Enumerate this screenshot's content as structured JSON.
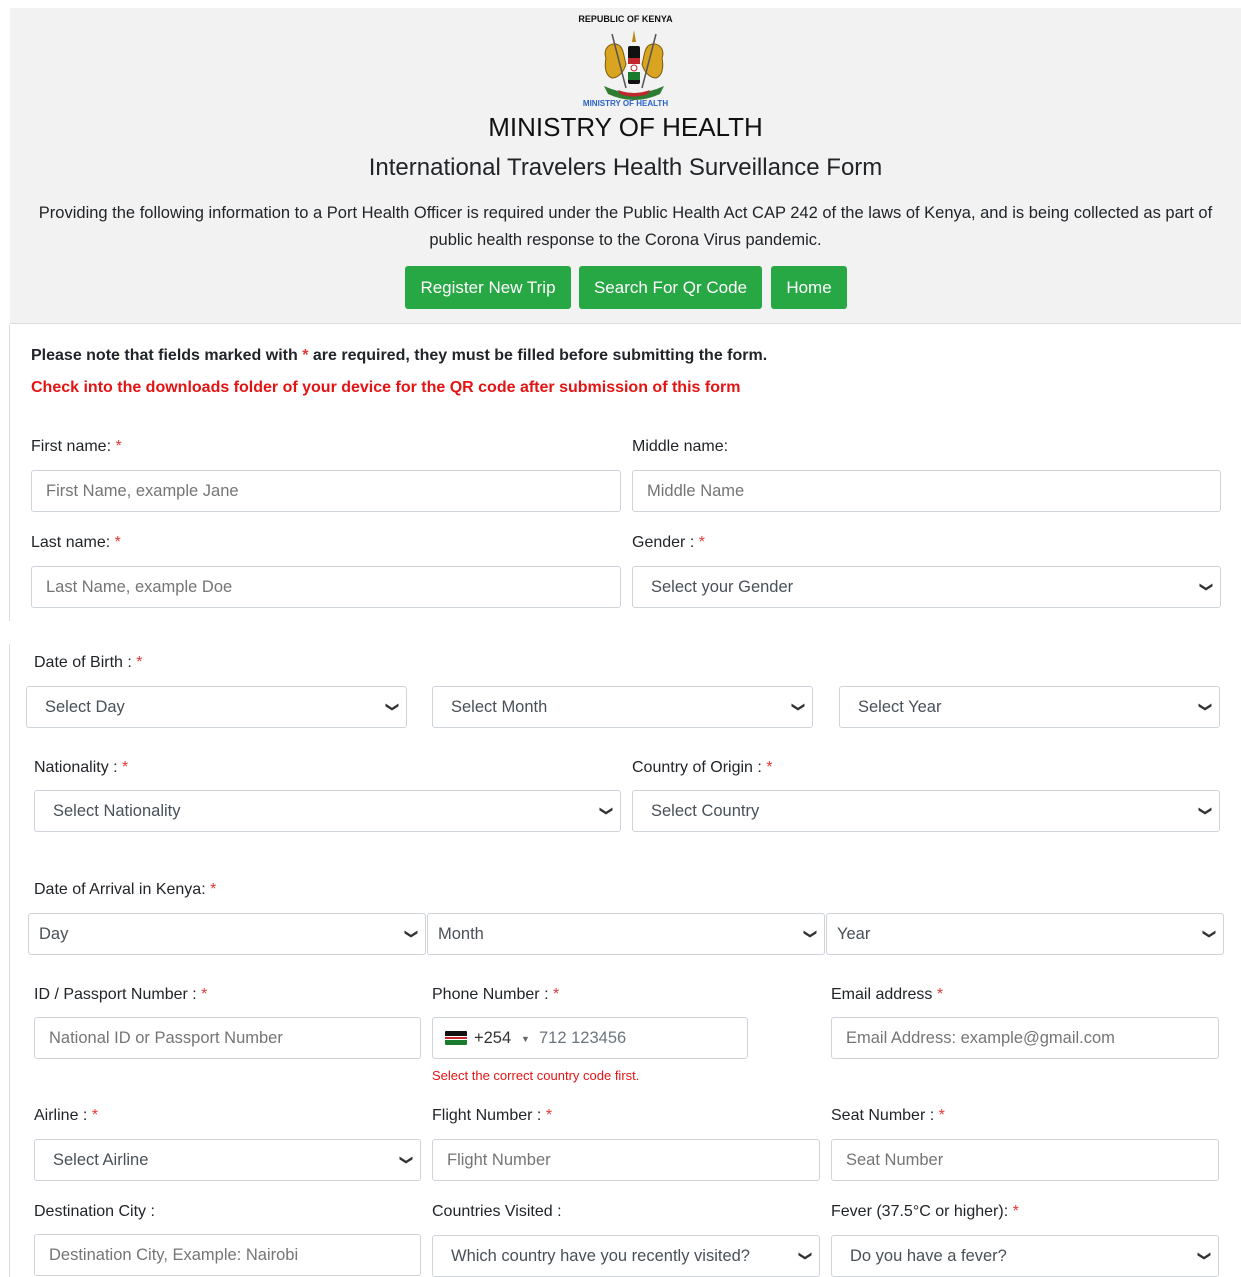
{
  "header": {
    "republic": "REPUBLIC OF KENYA",
    "ministry_small": "MINISTRY OF HEALTH",
    "ministry": "MINISTRY OF HEALTH",
    "title": "International Travelers Health Surveillance Form",
    "intro": "Providing the following information to a Port Health Officer is required under the Public Health Act CAP 242 of the laws of Kenya, and is being collected as part of public health response to the Corona Virus pandemic.",
    "nav": {
      "register": "Register New Trip",
      "search": "Search For Qr Code",
      "home": "Home"
    }
  },
  "notes": {
    "required_pre": "Please note that fields marked with ",
    "required_star": "*",
    "required_post": " are required, they must be filled before submitting the form.",
    "qr_warning": "Check into the downloads folder of your device for the QR code after submission of this form"
  },
  "form": {
    "first_name": {
      "label": "First name:",
      "placeholder": "First Name, example Jane"
    },
    "middle_name": {
      "label": "Middle name:",
      "placeholder": "Middle Name"
    },
    "last_name": {
      "label": "Last name:",
      "placeholder": "Last Name, example Doe"
    },
    "gender": {
      "label": "Gender :",
      "selected": "Select your Gender"
    },
    "dob": {
      "label": "Date of Birth :",
      "day": "Select Day",
      "month": "Select Month",
      "year": "Select Year"
    },
    "nationality": {
      "label": "Nationality :",
      "selected": "Select Nationality"
    },
    "country_origin": {
      "label": "Country of Origin :",
      "selected": "Select Country"
    },
    "arrival": {
      "label": "Date of Arrival in Kenya:",
      "day": "Day",
      "month": "Month",
      "year": "Year"
    },
    "passport": {
      "label": "ID / Passport Number :",
      "placeholder": "National ID or Passport Number"
    },
    "phone": {
      "label": "Phone Number :",
      "code": "+254",
      "placeholder": "712 123456",
      "help": "Select the correct country code first."
    },
    "email": {
      "label": "Email address",
      "placeholder": "Email Address: example@gmail.com"
    },
    "airline": {
      "label": "Airline :",
      "selected": "Select Airline"
    },
    "flight": {
      "label": "Flight Number :",
      "placeholder": "Flight Number"
    },
    "seat": {
      "label": "Seat Number :",
      "placeholder": "Seat Number"
    },
    "destination": {
      "label": "Destination City :",
      "placeholder": "Destination City, Example: Nairobi"
    },
    "countries_visited": {
      "label": "Countries Visited :",
      "selected": "Which country have you recently visited?"
    },
    "fever": {
      "label": "Fever (37.5°C or higher):",
      "selected": "Do you have a fever?"
    }
  },
  "colors": {
    "accent_green": "#28a745",
    "required_red": "#e53935",
    "warning_red": "#e51414"
  },
  "icons": {
    "crest": "kenya-coat-of-arms-icon",
    "select_arrow": "chevron-down-icon",
    "flag": "kenya-flag-icon"
  }
}
